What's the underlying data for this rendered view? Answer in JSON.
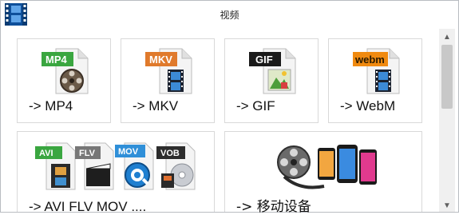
{
  "window": {
    "title": "视频"
  },
  "tiles": [
    {
      "label": "-> MP4",
      "badge": "MP4",
      "badge_color": "#3aa640",
      "icon": "film-reel-icon"
    },
    {
      "label": "-> MKV",
      "badge": "MKV",
      "badge_color": "#e07a2c",
      "icon": "film-strip-icon"
    },
    {
      "label": "-> GIF",
      "badge": "GIF",
      "badge_color": "#1a1a1a",
      "icon": "image-icon"
    },
    {
      "label": "-> WebM",
      "badge": "webm",
      "badge_color": "#f08a10",
      "icon": "film-strip-icon"
    },
    {
      "label": "-> AVI FLV MOV ....",
      "badges": [
        "AVI",
        "FLV",
        "MOV",
        "VOB"
      ],
      "icon": "multi-format-icon"
    },
    {
      "label": "-> 移动设备",
      "icon": "mobile-devices-icon"
    }
  ],
  "scrollbar": {
    "up": "▲",
    "down": "▼"
  }
}
